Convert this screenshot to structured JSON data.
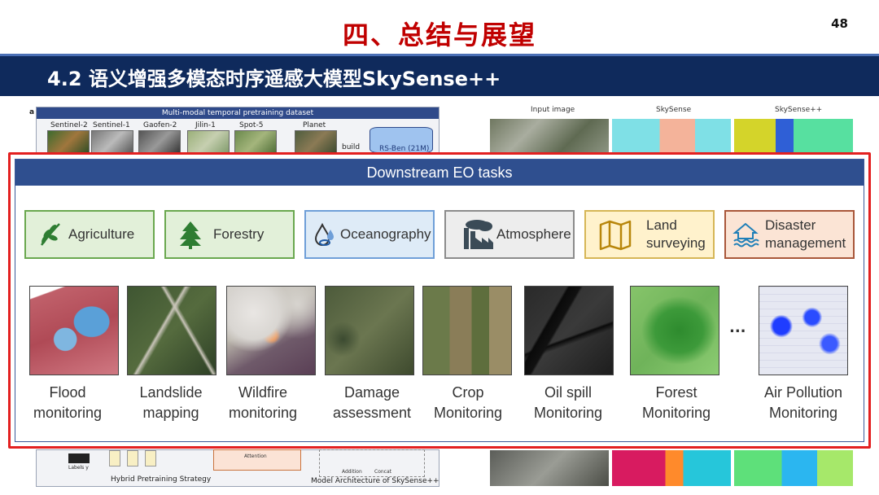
{
  "header": {
    "title": "四、总结与展望",
    "page_number": "48",
    "section_title": "4.2 语义增强多模态时序遥感大模型SkySense++"
  },
  "background_figure": {
    "panel_label": "a",
    "dataset_title": "Multi-modal temporal pretraining dataset",
    "sources": [
      "Sentinel-2",
      "Sentinel-1",
      "Gaofen-2",
      "Jilin-1",
      "Spot-5",
      "Planet"
    ],
    "build_label": "build",
    "db_label": "RS-Ben (21M)",
    "strategy_caption": "Hybrid Pretraining Strategy",
    "architecture_caption": "Model Architecture of SkySense++",
    "label_y": "Labels y",
    "attention_label": "Attention",
    "legend_addition": "Addition",
    "legend_concat": "Concat",
    "right_columns": [
      "Input image",
      "SkySense",
      "SkySense++"
    ]
  },
  "overlay": {
    "title": "Downstream EO tasks",
    "categories": [
      {
        "label": "Agriculture",
        "icon": "leaf-icon"
      },
      {
        "label": "Forestry",
        "icon": "tree-icon"
      },
      {
        "label": "Oceanography",
        "icon": "water-drop-icon"
      },
      {
        "label": "Atmosphere",
        "icon": "factory-icon"
      },
      {
        "label_line1": "Land",
        "label_line2": "surveying",
        "icon": "map-icon"
      },
      {
        "label_line1": "Disaster",
        "label_line2": "management",
        "icon": "flood-house-icon"
      }
    ],
    "tasks": [
      {
        "line1": "Flood",
        "line2": "monitoring"
      },
      {
        "line1": "Landslide",
        "line2": "mapping"
      },
      {
        "line1": "Wildfire",
        "line2": "monitoring"
      },
      {
        "line1": "Damage",
        "line2": "assessment"
      },
      {
        "line1": "Crop",
        "line2": "Monitoring"
      },
      {
        "line1": "Oil spill",
        "line2": "Monitoring"
      },
      {
        "line1": "Forest",
        "line2": "Monitoring"
      },
      {
        "line1": "Air Pollution",
        "line2": "Monitoring"
      }
    ],
    "ellipsis": "..."
  },
  "colors": {
    "title_red": "#c00000",
    "section_bar": "#0f2a5c",
    "overlay_border": "#e32020",
    "tasks_header": "#2f4f8f",
    "agri_green": "#6aa84f",
    "ocean_blue": "#6f9fd8",
    "atmos_gray": "#8c8c8c",
    "land_gold": "#d6b656",
    "disaster_brown": "#a9573a"
  }
}
